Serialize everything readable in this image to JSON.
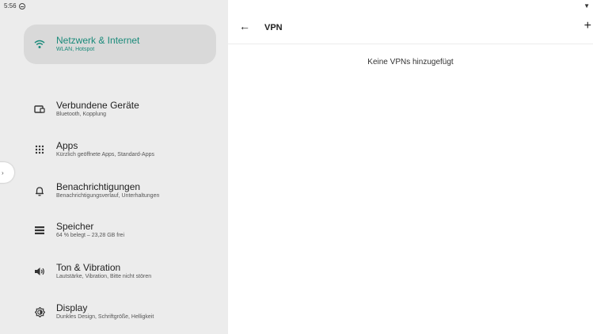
{
  "status_bar": {
    "time": "5:56",
    "wifi_icon": "wifi-icon"
  },
  "settings_nav": {
    "items": [
      {
        "title": "Netzwerk & Internet",
        "subtitle": "WLAN, Hotspot",
        "icon": "wifi-icon",
        "active": true
      },
      {
        "title": "Verbundene Geräte",
        "subtitle": "Bluetooth, Kopplung",
        "icon": "devices-icon",
        "active": false
      },
      {
        "title": "Apps",
        "subtitle": "Kürzlich geöffnete Apps, Standard-Apps",
        "icon": "apps-grid-icon",
        "active": false
      },
      {
        "title": "Benachrichtigungen",
        "subtitle": "Benachrichtigungsverlauf, Unterhaltungen",
        "icon": "bell-icon",
        "active": false
      },
      {
        "title": "Speicher",
        "subtitle": "64 % belegt – 23,28 GB frei",
        "icon": "storage-icon",
        "active": false
      },
      {
        "title": "Ton & Vibration",
        "subtitle": "Lautstärke, Vibration, Bitte nicht stören",
        "icon": "volume-icon",
        "active": false
      },
      {
        "title": "Display",
        "subtitle": "Dunkles Design, Schriftgröße, Helligkeit",
        "icon": "brightness-icon",
        "active": false
      }
    ]
  },
  "vpn_page": {
    "back_icon": "arrow-left-icon",
    "title": "VPN",
    "add_icon": "plus-icon",
    "empty_message": "Keine VPNs hinzugefügt"
  },
  "colors": {
    "accent": "#1a8a7a",
    "nav_background": "#ececec",
    "active_item": "#d9d9d9"
  }
}
